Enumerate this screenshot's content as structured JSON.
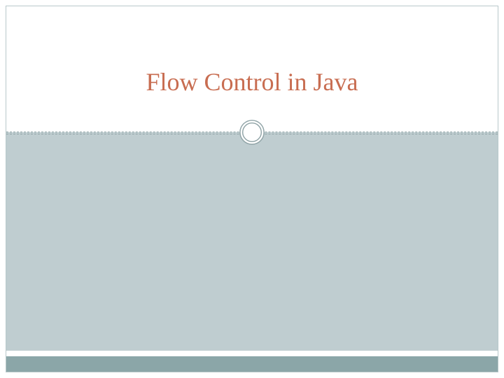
{
  "slide": {
    "title": "Flow Control in Java"
  },
  "colors": {
    "title_text": "#c86d51",
    "body_bg": "#bfcdd0",
    "footer_bg": "#8ba6a8",
    "border": "#b8c8ca"
  }
}
